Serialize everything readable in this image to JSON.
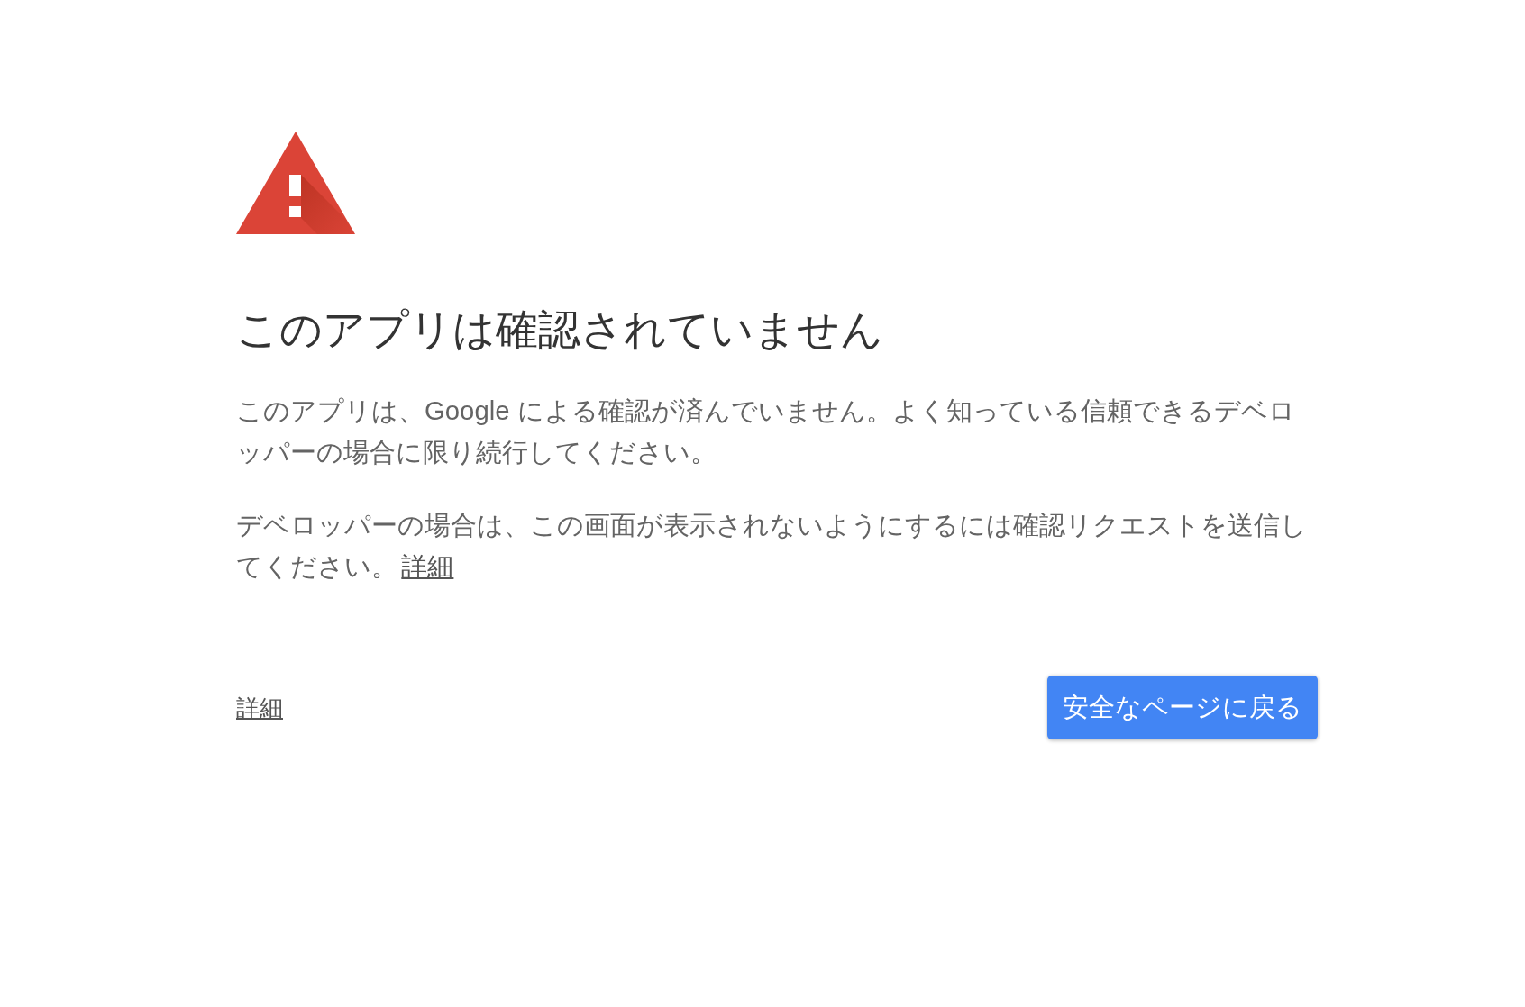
{
  "heading": "このアプリは確認されていません",
  "paragraphs": [
    {
      "text": "このアプリは、Google による確認が済んでいません。よく知っている信頼できるデベロッパーの場合に限り続行してください。"
    },
    {
      "text": "デベロッパーの場合は、この画面が表示されないようにするには確認リクエストを送信してください。",
      "link": "詳細"
    }
  ],
  "details_link": "詳細",
  "back_button": "安全なページに戻る"
}
